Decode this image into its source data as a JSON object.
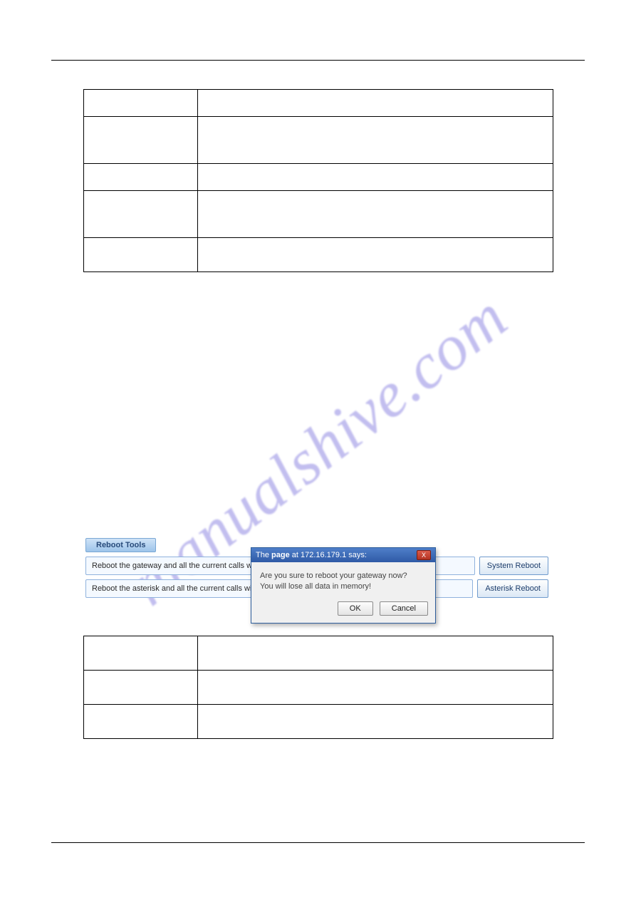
{
  "watermark": "manualshive.com",
  "tables": {
    "t1": [
      {
        "c0": "",
        "c1": ""
      },
      {
        "c0": "",
        "c1": ""
      },
      {
        "c0": "",
        "c1": ""
      },
      {
        "c0": "",
        "c1": ""
      },
      {
        "c0": "",
        "c1": ""
      }
    ],
    "t2": [
      {
        "c0": "",
        "c1": ""
      },
      {
        "c0": "",
        "c1": ""
      },
      {
        "c0": "",
        "c1": ""
      }
    ]
  },
  "reboot_panel": {
    "title": "Reboot Tools",
    "rows": [
      {
        "message": "Reboot the gateway and all the current calls will be",
        "button": "System Reboot"
      },
      {
        "message": "Reboot the asterisk and all the current calls will be",
        "button": "Asterisk Reboot"
      }
    ]
  },
  "dialog": {
    "title_prefix": "The ",
    "title_bold": "page",
    "title_rest": " at 172.16.179.1 says:",
    "line1": "Are you sure to reboot your gateway now?",
    "line2": "You will lose all data in memory!",
    "ok": "OK",
    "cancel": "Cancel",
    "close": "X"
  }
}
